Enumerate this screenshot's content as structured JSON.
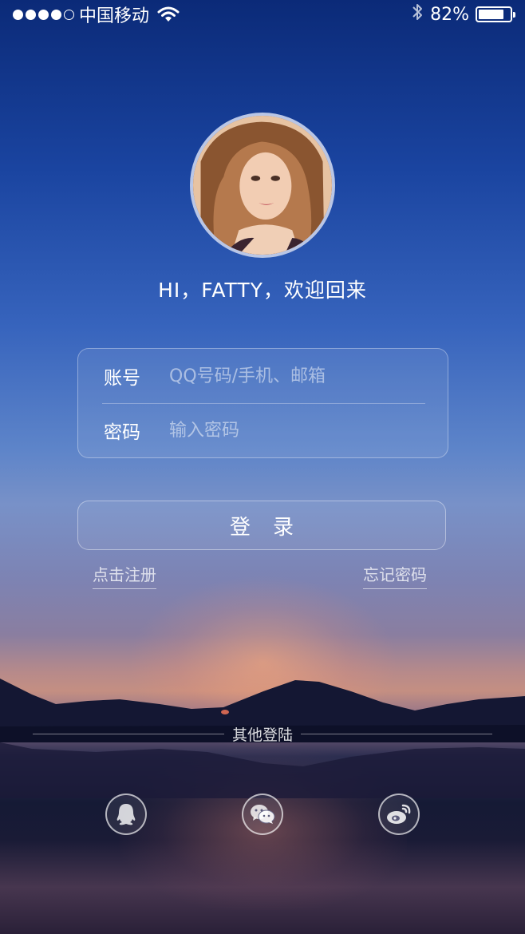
{
  "status_bar": {
    "carrier": "中国移动",
    "battery_text": "82%",
    "battery_level": 0.82,
    "signal_bars_filled": 4,
    "signal_bars_total": 5,
    "icons": [
      "wifi-icon",
      "bluetooth-icon",
      "battery-icon"
    ]
  },
  "profile": {
    "greeting": "HI，FATTY，欢迎回来"
  },
  "login_form": {
    "account_label": "账号",
    "account_placeholder": "QQ号码/手机、邮箱",
    "password_label": "密码",
    "password_placeholder": "输入密码",
    "login_button": "登录"
  },
  "links": {
    "register": "点击注册",
    "forgot_password": "忘记密码"
  },
  "other_login": {
    "title": "其他登陆",
    "providers": [
      "qq-icon",
      "wechat-icon",
      "weibo-icon"
    ]
  },
  "colors": {
    "top_sky": "#0b2a78",
    "mid_sky": "#5d84c9",
    "sunset": "#c48f82"
  }
}
